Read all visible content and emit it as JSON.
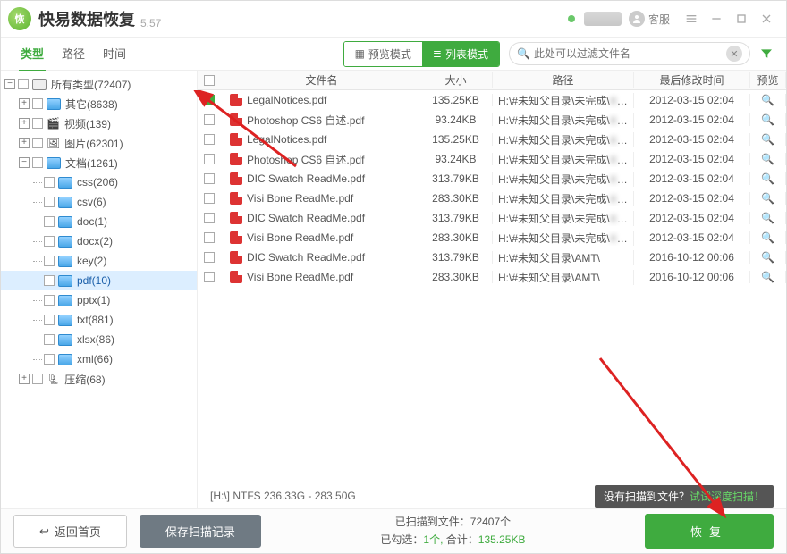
{
  "app": {
    "title": "快易数据恢复",
    "version": "5.57",
    "service_label": "客服"
  },
  "toolbar_tabs": {
    "type": "类型",
    "path": "路径",
    "time": "时间"
  },
  "mode": {
    "preview": "预览模式",
    "list": "列表模式"
  },
  "search": {
    "placeholder": "此处可以过滤文件名"
  },
  "tree": {
    "root": "所有类型(72407)",
    "other": "其它(8638)",
    "video": "视频(139)",
    "image": "图片(62301)",
    "doc": "文档(1261)",
    "css": "css(206)",
    "csv": "csv(6)",
    "d_doc": "doc(1)",
    "docx": "docx(2)",
    "key": "key(2)",
    "pdf": "pdf(10)",
    "pptx": "pptx(1)",
    "txt": "txt(881)",
    "xlsx": "xlsx(86)",
    "xml": "xml(66)",
    "zip": "压缩(68)"
  },
  "columns": {
    "name": "文件名",
    "size": "大小",
    "path": "路径",
    "time": "最后修改时间",
    "preview": "预览"
  },
  "rows": [
    {
      "checked": true,
      "name": "LegalNotices.pdf",
      "size": "135.25KB",
      "path": "H:\\#未知父目录\\未完成\\",
      "path_blur": true,
      "time": "2012-03-15  02:04"
    },
    {
      "checked": false,
      "name": "Photoshop CS6 自述.pdf",
      "size": "93.24KB",
      "path": "H:\\#未知父目录\\未完成\\",
      "path_blur": true,
      "time": "2012-03-15  02:04"
    },
    {
      "checked": false,
      "name": "LegalNotices.pdf",
      "size": "135.25KB",
      "path": "H:\\#未知父目录\\未完成\\",
      "path_blur": true,
      "time": "2012-03-15  02:04"
    },
    {
      "checked": false,
      "name": "Photoshop CS6 自述.pdf",
      "size": "93.24KB",
      "path": "H:\\#未知父目录\\未完成\\",
      "path_blur": true,
      "time": "2012-03-15  02:04"
    },
    {
      "checked": false,
      "name": "DIC Swatch ReadMe.pdf",
      "size": "313.79KB",
      "path": "H:\\#未知父目录\\未完成\\",
      "path_blur": true,
      "time": "2012-03-15  02:04"
    },
    {
      "checked": false,
      "name": "Visi Bone ReadMe.pdf",
      "size": "283.30KB",
      "path": "H:\\#未知父目录\\未完成\\",
      "path_blur": true,
      "time": "2012-03-15  02:04"
    },
    {
      "checked": false,
      "name": "DIC Swatch ReadMe.pdf",
      "size": "313.79KB",
      "path": "H:\\#未知父目录\\未完成\\",
      "path_blur": true,
      "time": "2012-03-15  02:04"
    },
    {
      "checked": false,
      "name": "Visi Bone ReadMe.pdf",
      "size": "283.30KB",
      "path": "H:\\#未知父目录\\未完成\\",
      "path_blur": true,
      "time": "2012-03-15  02:04"
    },
    {
      "checked": false,
      "name": "DIC Swatch ReadMe.pdf",
      "size": "313.79KB",
      "path": "H:\\#未知父目录\\AMT\\",
      "path_blur": false,
      "time": "2016-10-12  00:06"
    },
    {
      "checked": false,
      "name": "Visi Bone ReadMe.pdf",
      "size": "283.30KB",
      "path": "H:\\#未知父目录\\AMT\\",
      "path_blur": false,
      "time": "2016-10-12  00:06"
    }
  ],
  "disk_info": "[H:\\] NTFS 236.33G - 283.50G",
  "deep_scan": {
    "a": "没有扫描到文件？",
    "b": "试试深度扫描！"
  },
  "footer": {
    "back": "返回首页",
    "save_scan": "保存扫描记录",
    "counts_l1_a": "已扫描到文件：",
    "counts_l1_b": "72407个",
    "counts_l2_a": "已勾选：",
    "counts_l2_b": "1个,",
    "counts_l2_c": " 合计：",
    "counts_l2_d": "135.25KB",
    "recover": "恢复"
  }
}
